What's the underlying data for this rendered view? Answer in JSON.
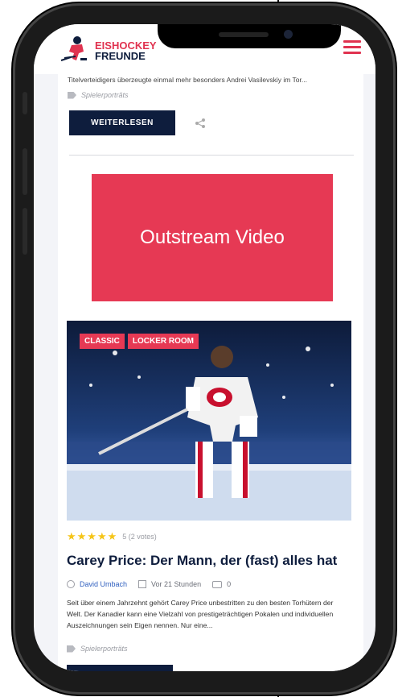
{
  "header": {
    "brand_line1": "EISHOCKEY",
    "brand_line2": "FREUNDE"
  },
  "prev_article": {
    "excerpt_tail": "Titelverteidigers überzeugte einmal mehr besonders Andrei Vasilevskiy im Tor...",
    "category": "Spielerporträts",
    "read_more": "WEITERLESEN"
  },
  "ad": {
    "label": "Outstream Video"
  },
  "article": {
    "badges": [
      "CLASSIC",
      "LOCKER ROOM"
    ],
    "stars": "★★★★★",
    "votes": "5 (2 votes)",
    "title": "Carey Price: Der Mann, der (fast) alles hat",
    "author": "David Umbach",
    "date": "Vor 21 Stunden",
    "comments": "0",
    "excerpt": "Seit über einem Jahrzehnt gehört Carey Price unbestritten zu den besten Torhütern der Welt. Der Kanadier kann eine Vielzahl von prestigeträchtigen Pokalen und individuellen Auszeichnungen sein Eigen nennen. Nur eine...",
    "category": "Spielerporträts"
  },
  "colors": {
    "accent": "#e63954",
    "navy": "#0e1d3d",
    "link": "#2f5fbf"
  }
}
